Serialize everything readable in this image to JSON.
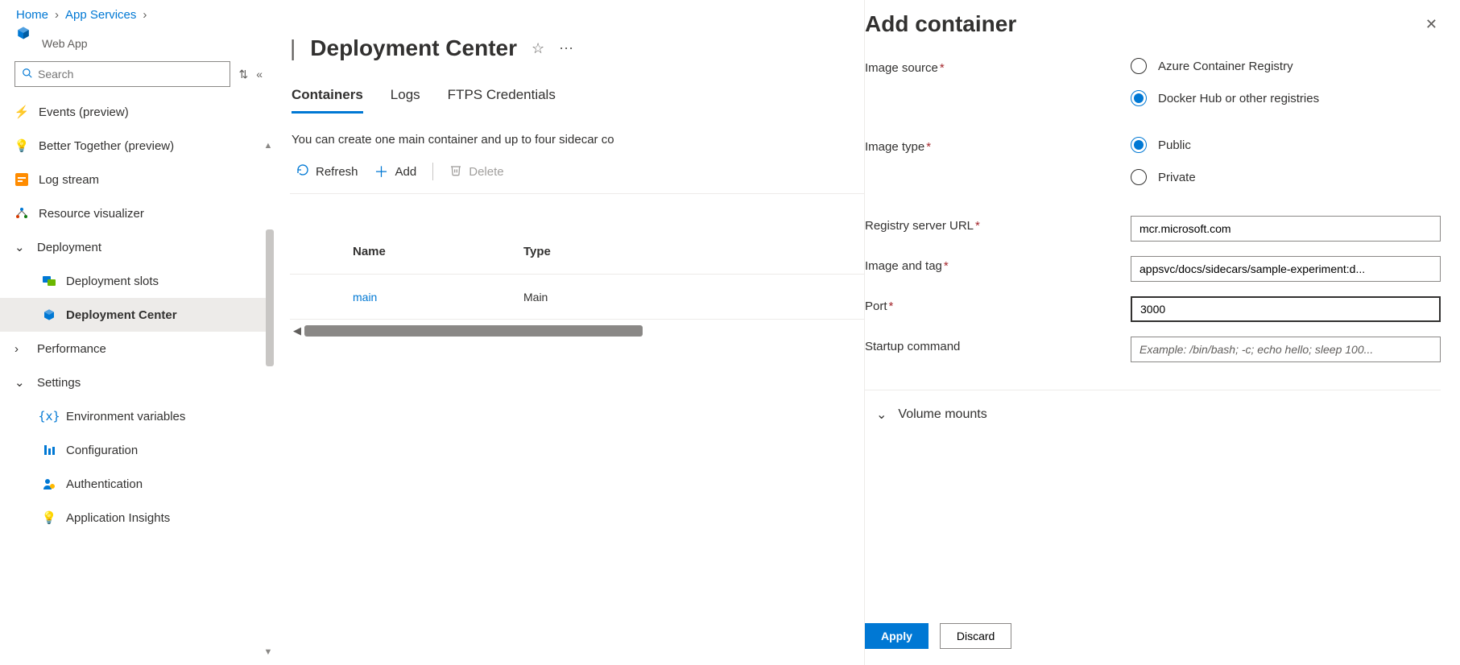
{
  "breadcrumb": {
    "home": "Home",
    "appServices": "App Services"
  },
  "resource": {
    "type": "Web App"
  },
  "search": {
    "placeholder": "Search"
  },
  "nav": {
    "events": "Events (preview)",
    "betterTogether": "Better Together (preview)",
    "logStream": "Log stream",
    "resourceVisualizer": "Resource visualizer",
    "deployment": "Deployment",
    "deploymentSlots": "Deployment slots",
    "deploymentCenter": "Deployment Center",
    "performance": "Performance",
    "settings": "Settings",
    "envVars": "Environment variables",
    "configuration": "Configuration",
    "authentication": "Authentication",
    "appInsights": "Application Insights"
  },
  "page": {
    "title": "Deployment Center"
  },
  "tabs": {
    "containers": "Containers",
    "logs": "Logs",
    "ftps": "FTPS Credentials"
  },
  "info": "You can create one main container and up to four sidecar co",
  "toolbar": {
    "refresh": "Refresh",
    "add": "Add",
    "delete": "Delete"
  },
  "table": {
    "headers": {
      "name": "Name",
      "type": "Type"
    },
    "rows": [
      {
        "name": "main",
        "type": "Main"
      }
    ]
  },
  "panel": {
    "title": "Add container",
    "labels": {
      "imageSource": "Image source",
      "imageType": "Image type",
      "registryUrl": "Registry server URL",
      "imageTag": "Image and tag",
      "port": "Port",
      "startup": "Startup command",
      "volumeMounts": "Volume mounts"
    },
    "options": {
      "acr": "Azure Container Registry",
      "dockerHub": "Docker Hub or other registries",
      "public": "Public",
      "private": "Private"
    },
    "values": {
      "registryUrl": "mcr.microsoft.com",
      "imageTag": "appsvc/docs/sidecars/sample-experiment:d...",
      "port": "3000"
    },
    "placeholders": {
      "startup": "Example: /bin/bash; -c; echo hello; sleep 100..."
    },
    "buttons": {
      "apply": "Apply",
      "discard": "Discard"
    }
  }
}
